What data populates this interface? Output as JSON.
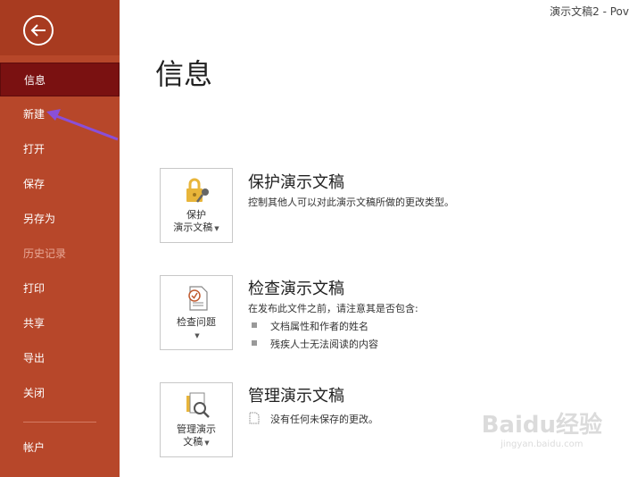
{
  "window": {
    "title": "演示文稿2  -  Pov"
  },
  "sidebar": {
    "back_label": "",
    "items": [
      {
        "label": "信息"
      },
      {
        "label": "新建"
      },
      {
        "label": "打开"
      },
      {
        "label": "保存"
      },
      {
        "label": "另存为"
      },
      {
        "label": "历史记录"
      },
      {
        "label": "打印"
      },
      {
        "label": "共享"
      },
      {
        "label": "导出"
      },
      {
        "label": "关闭"
      },
      {
        "label": "帐户"
      }
    ]
  },
  "main": {
    "title": "信息",
    "sections": [
      {
        "button_line1": "保护",
        "button_line2": "演示文稿",
        "title": "保护演示文稿",
        "desc": "控制其他人可以对此演示文稿所做的更改类型。"
      },
      {
        "button_line1": "检查问题",
        "title": "检查演示文稿",
        "desc": "在发布此文件之前，请注意其是否包含:",
        "bullets": [
          "文档属性和作者的姓名",
          "残疾人士无法阅读的内容"
        ]
      },
      {
        "button_line1": "管理演示",
        "button_line2": "文稿",
        "title": "管理演示文稿",
        "desc": "没有任何未保存的更改。"
      }
    ]
  },
  "watermark": {
    "text": "Baidu经验",
    "sub": "jingyan.baidu.com"
  },
  "colors": {
    "sidebar": "#b7472a",
    "active": "#7a1111",
    "annotation": "#8a4fd8"
  }
}
